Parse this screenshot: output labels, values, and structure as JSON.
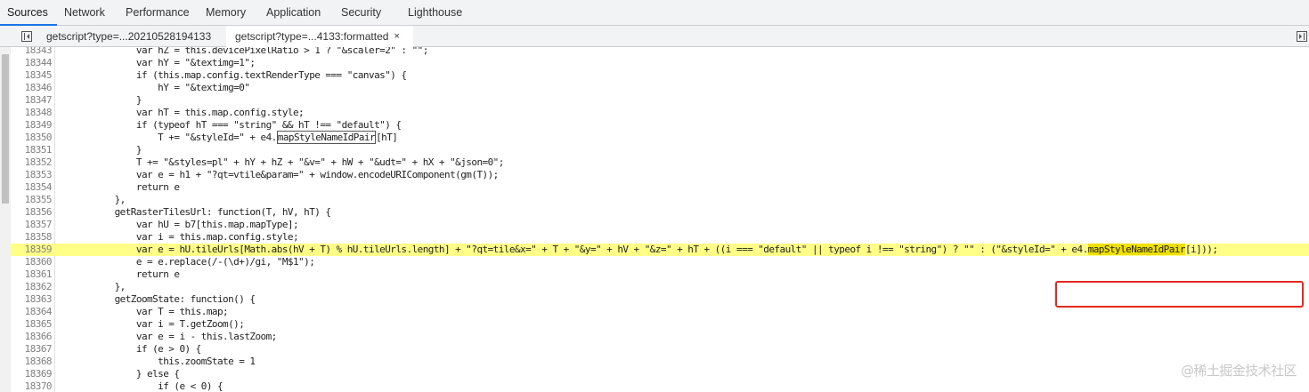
{
  "devtools_tabs": [
    "Sources",
    "Network",
    "Performance",
    "Memory",
    "Application",
    "Security",
    "Lighthouse"
  ],
  "active_devtools_tab": "Sources",
  "file_tabs": [
    {
      "label": "getscript?type=...20210528194133",
      "active": false
    },
    {
      "label": "getscript?type=...4133:formatted",
      "active": true,
      "close": "×"
    }
  ],
  "code_lines": [
    {
      "n": "18343",
      "text": "            var hZ = this.devicePixelRatio > 1 ? \"&scaler=2\" : \"\";"
    },
    {
      "n": "18344",
      "text": "            var hY = \"&textimg=1\";"
    },
    {
      "n": "18345",
      "text": "            if (this.map.config.textRenderType === \"canvas\") {"
    },
    {
      "n": "18346",
      "text": "                hY = \"&textimg=0\""
    },
    {
      "n": "18347",
      "text": "            }"
    },
    {
      "n": "18348",
      "text": "            var hT = this.map.config.style;"
    },
    {
      "n": "18349",
      "text": "            if (typeof hT === \"string\" && hT !== \"default\") {"
    },
    {
      "n": "18350",
      "pre": "                T += \"&styleId=\" + e4.",
      "boxed": "mapStyleNameIdPair",
      "post": "[hT]"
    },
    {
      "n": "18351",
      "text": "            }"
    },
    {
      "n": "18352",
      "text": "            T += \"&styles=pl\" + hY + hZ + \"&v=\" + hW + \"&udt=\" + hX + \"&json=0\";"
    },
    {
      "n": "18353",
      "text": "            var e = h1 + \"?qt=vtile&param=\" + window.encodeURIComponent(gm(T));"
    },
    {
      "n": "18354",
      "text": "            return e"
    },
    {
      "n": "18355",
      "text": "        },"
    },
    {
      "n": "18356",
      "text": "        getRasterTilesUrl: function(T, hV, hT) {"
    },
    {
      "n": "18357",
      "text": "            var hU = b7[this.map.mapType];"
    },
    {
      "n": "18358",
      "text": "            var i = this.map.config.style;"
    },
    {
      "n": "18359",
      "highlight": true,
      "pre": "            var e = hU.tileUrls[Math.abs(hV + T) % hU.tileUrls.length] + \"?qt=tile&x=\" + T + \"&y=\" + hV + \"&z=\" + hT + ((i === \"default\" || typeof i !== \"string\") ? \"\" : (\"&styleId=\" + e4.",
      "marked": "mapStyleNameIdPair",
      "post": "[i]));"
    },
    {
      "n": "18360",
      "text": "            e = e.replace(/-(\\d+)/gi, \"M$1\");"
    },
    {
      "n": "18361",
      "text": "            return e"
    },
    {
      "n": "18362",
      "text": "        },"
    },
    {
      "n": "18363",
      "text": "        getZoomState: function() {"
    },
    {
      "n": "18364",
      "text": "            var T = this.map;"
    },
    {
      "n": "18365",
      "text": "            var i = T.getZoom();"
    },
    {
      "n": "18366",
      "text": "            var e = i - this.lastZoom;"
    },
    {
      "n": "18367",
      "text": "            if (e > 0) {"
    },
    {
      "n": "18368",
      "text": "                this.zoomState = 1"
    },
    {
      "n": "18369",
      "text": "            } else {"
    },
    {
      "n": "18370",
      "text": "                if (e < 0) {"
    }
  ],
  "watermark": "@稀土掘金技术社区",
  "colors": {
    "line_highlight": "#ffff88",
    "search_match": "#f0e000",
    "annotation_box": "#e3281e",
    "active_tab_underline": "#1a73e8"
  }
}
